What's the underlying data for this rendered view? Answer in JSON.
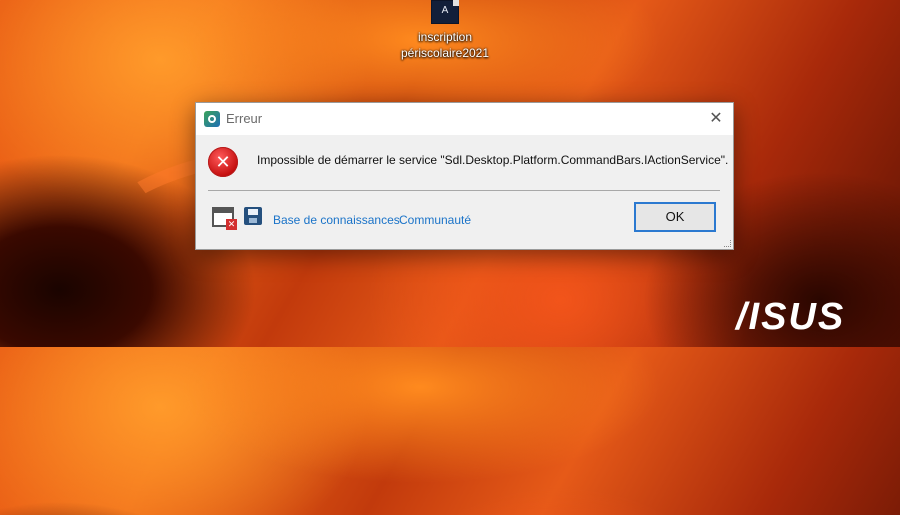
{
  "desktop": {
    "icon_glyph": "A",
    "icon_label_line1": "inscription",
    "icon_label_line2": "périscolaire2021",
    "brand": "/ISUS"
  },
  "dialog": {
    "title": "Erreur",
    "close_glyph": "✕",
    "error_glyph": "✕",
    "message": "Impossible de démarrer le service \"Sdl.Desktop.Platform.CommandBars.IActionService\".",
    "link_knowledge_base": "Base de connaissances",
    "link_community": "Communauté",
    "ok_label": "OK",
    "tool_window_glyph": "✕"
  },
  "colors": {
    "link": "#1a73c8",
    "error": "#c40e0e",
    "ok_border": "#2b79d0"
  }
}
